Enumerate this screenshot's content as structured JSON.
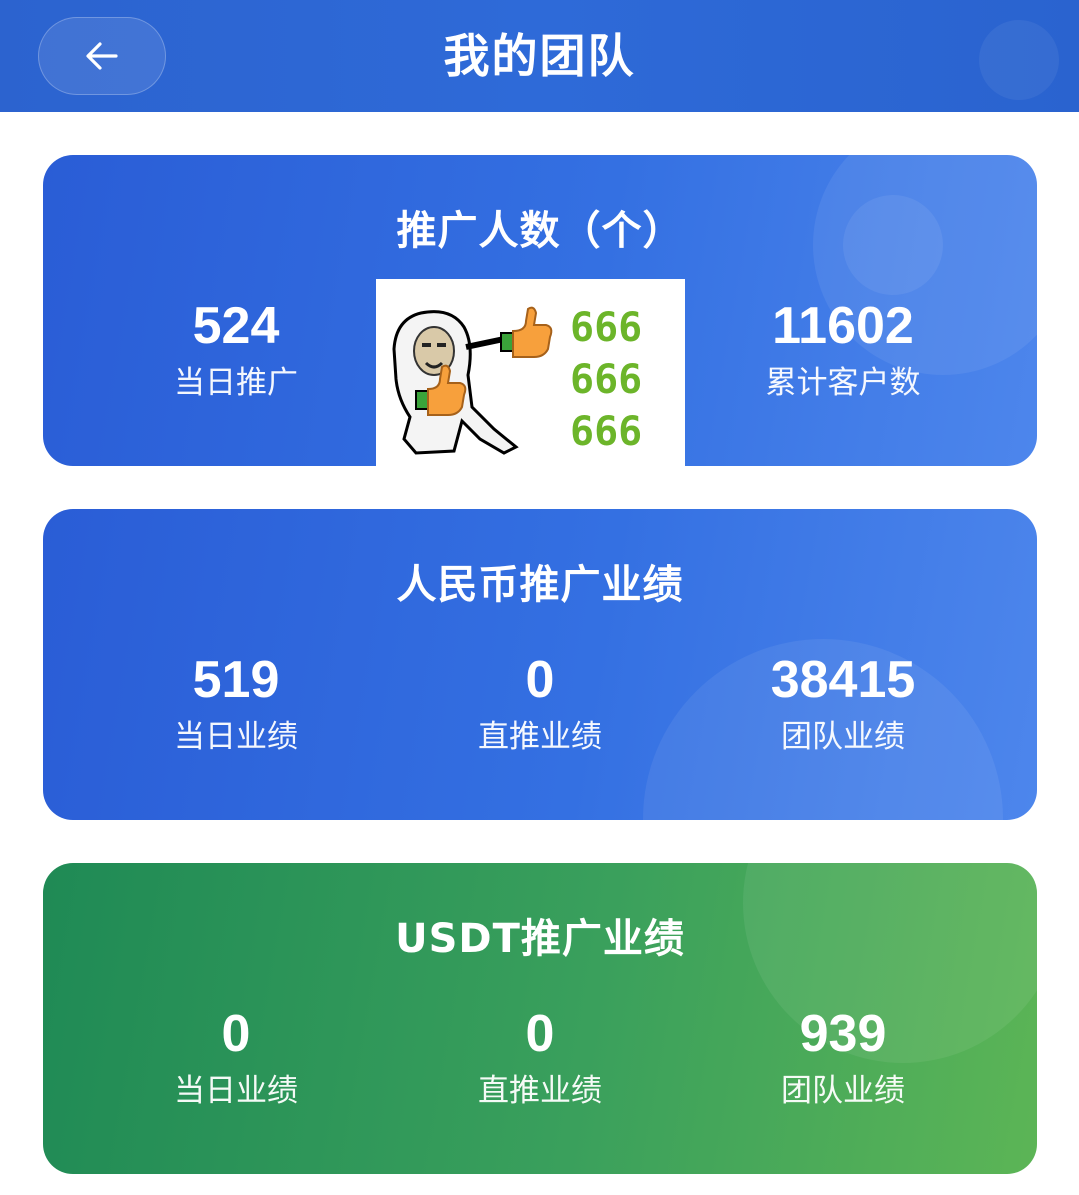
{
  "header": {
    "title": "我的团队",
    "background": "#2c63cf"
  },
  "cards": {
    "promotion_count": {
      "title": "推广人数（个）",
      "stats": [
        {
          "value": "524",
          "label": "当日推广"
        },
        {
          "value": "11602",
          "label": "累计客户数"
        }
      ],
      "sticker": {
        "icon": "thumbs-up-meme-sticker",
        "lines": [
          "666",
          "666",
          "666"
        ]
      },
      "color": "#2f67dc"
    },
    "rmb_performance": {
      "title": "人民币推广业绩",
      "stats": [
        {
          "value": "519",
          "label": "当日业绩"
        },
        {
          "value": "0",
          "label": "直推业绩"
        },
        {
          "value": "38415",
          "label": "团队业绩"
        }
      ],
      "color": "#2f67dc"
    },
    "usdt_performance": {
      "title": "USDT推广业绩",
      "stats": [
        {
          "value": "0",
          "label": "当日业绩"
        },
        {
          "value": "0",
          "label": "直推业绩"
        },
        {
          "value": "939",
          "label": "团队业绩"
        }
      ],
      "color": "#2f9657"
    }
  }
}
